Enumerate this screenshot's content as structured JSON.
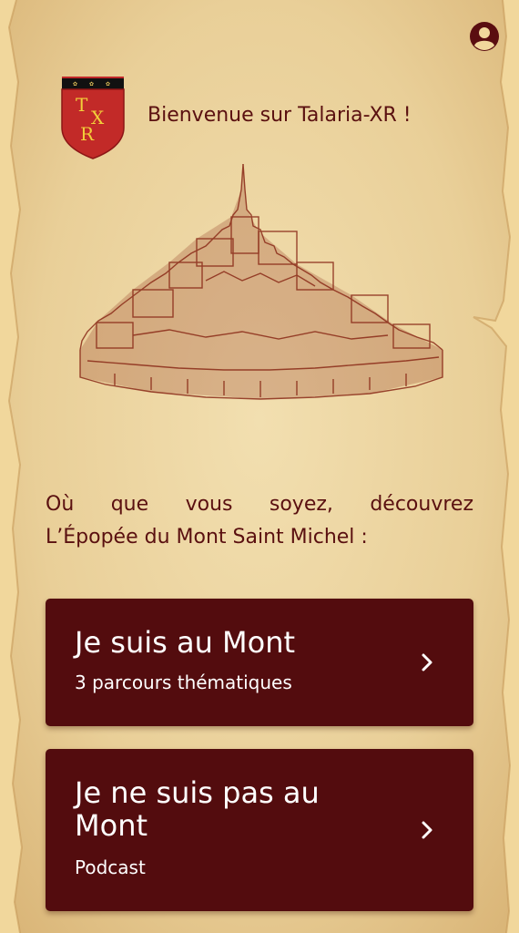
{
  "header": {
    "welcome_text": "Bienvenue sur Talaria-XR !",
    "logo_text": "TXR",
    "account_icon": "account-circle-icon"
  },
  "intro": {
    "line1_words": [
      "Où",
      "que",
      "vous",
      "soyez,",
      "découvrez"
    ],
    "line2": "L’Épopée du Mont Saint Michel :"
  },
  "cards": [
    {
      "title": "Je suis au Mont",
      "subtitle": "3 parcours thématiques",
      "icon": "chevron-right-icon"
    },
    {
      "title": "Je ne suis pas au Mont",
      "subtitle": "Podcast",
      "icon": "chevron-right-icon"
    }
  ],
  "colors": {
    "accent": "#530c0e",
    "text": "#5a1010",
    "parchment": "#e8cf98"
  }
}
